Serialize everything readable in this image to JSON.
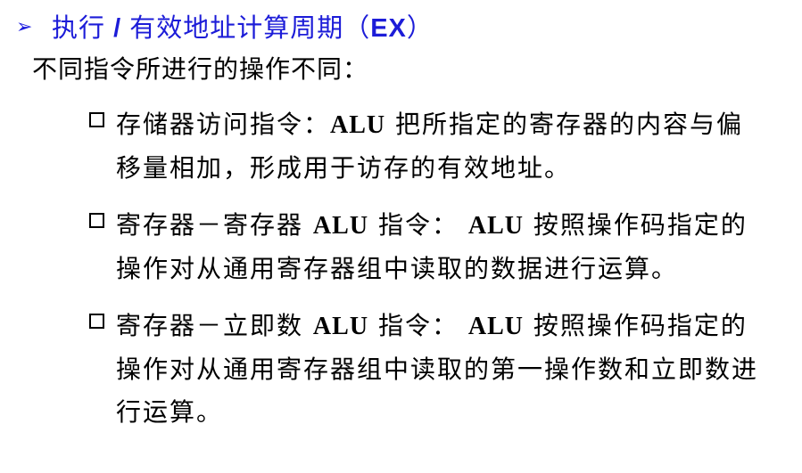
{
  "header": {
    "bullet_icon": "arrowhead-right-icon",
    "title_part1": "执行",
    "title_slash": " / ",
    "title_part2": "有效地址计算周期（",
    "title_abbr": "EX",
    "title_close": "）"
  },
  "subtitle": "不同指令所进行的操作不同：",
  "items": [
    {
      "icon": "square-bullet-icon",
      "segments": [
        "存储器访问指令：",
        "ALU",
        "把所指定的寄存器的内容与偏移量相加，形成用于访存的有效地址。"
      ]
    },
    {
      "icon": "square-bullet-icon",
      "segments": [
        "寄存器－寄存器",
        "ALU",
        "指令：",
        "ALU",
        "按照操作码指定的操作对从通用寄存器组中读取的数据进行运算。"
      ]
    },
    {
      "icon": "square-bullet-icon",
      "segments": [
        "寄存器－立即数",
        "ALU",
        "指令：",
        "ALU",
        "按照操作码指定的操作对从通用寄存器组中读取的第一操作数和立即数进行运算。"
      ]
    }
  ],
  "colors": {
    "title": "#1c1cd8",
    "bullet": "#1a1adf",
    "text": "#000000"
  }
}
